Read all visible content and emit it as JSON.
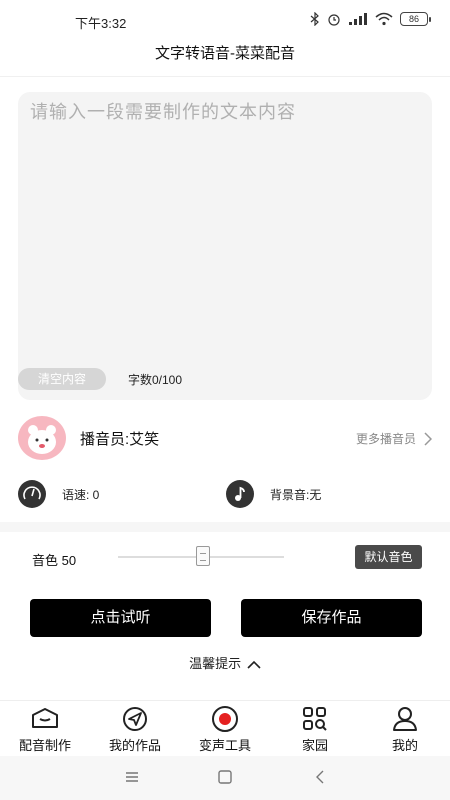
{
  "status_bar": {
    "time": "下午3:32",
    "battery": "86"
  },
  "app": {
    "title": "文字转语音-菜菜配音"
  },
  "editor": {
    "placeholder": "请输入一段需要制作的文本内容",
    "value": "",
    "clear_label": "清空内容",
    "word_count": "字数0/100"
  },
  "narrator": {
    "name_label": "播音员:艾笑",
    "more_label": "更多播音员"
  },
  "settings": {
    "speed_label": "语速: 0",
    "bgm_label": "背景音:无"
  },
  "timbre": {
    "label": "音色 50",
    "value": 50,
    "default_button_label": "默认音色"
  },
  "actions": {
    "listen_label": "点击试听",
    "save_label": "保存作品"
  },
  "tips": {
    "label": "温馨提示"
  },
  "tab_bar": {
    "tabs": [
      {
        "label": "配音制作",
        "icon": "graduation-cap-icon"
      },
      {
        "label": "我的作品",
        "icon": "compass-arrow-icon"
      },
      {
        "label": "变声工具",
        "icon": "record-icon"
      },
      {
        "label": "家园",
        "icon": "grid-search-icon"
      },
      {
        "label": "我的",
        "icon": "user-icon"
      }
    ],
    "accent_color": "#e52020"
  }
}
